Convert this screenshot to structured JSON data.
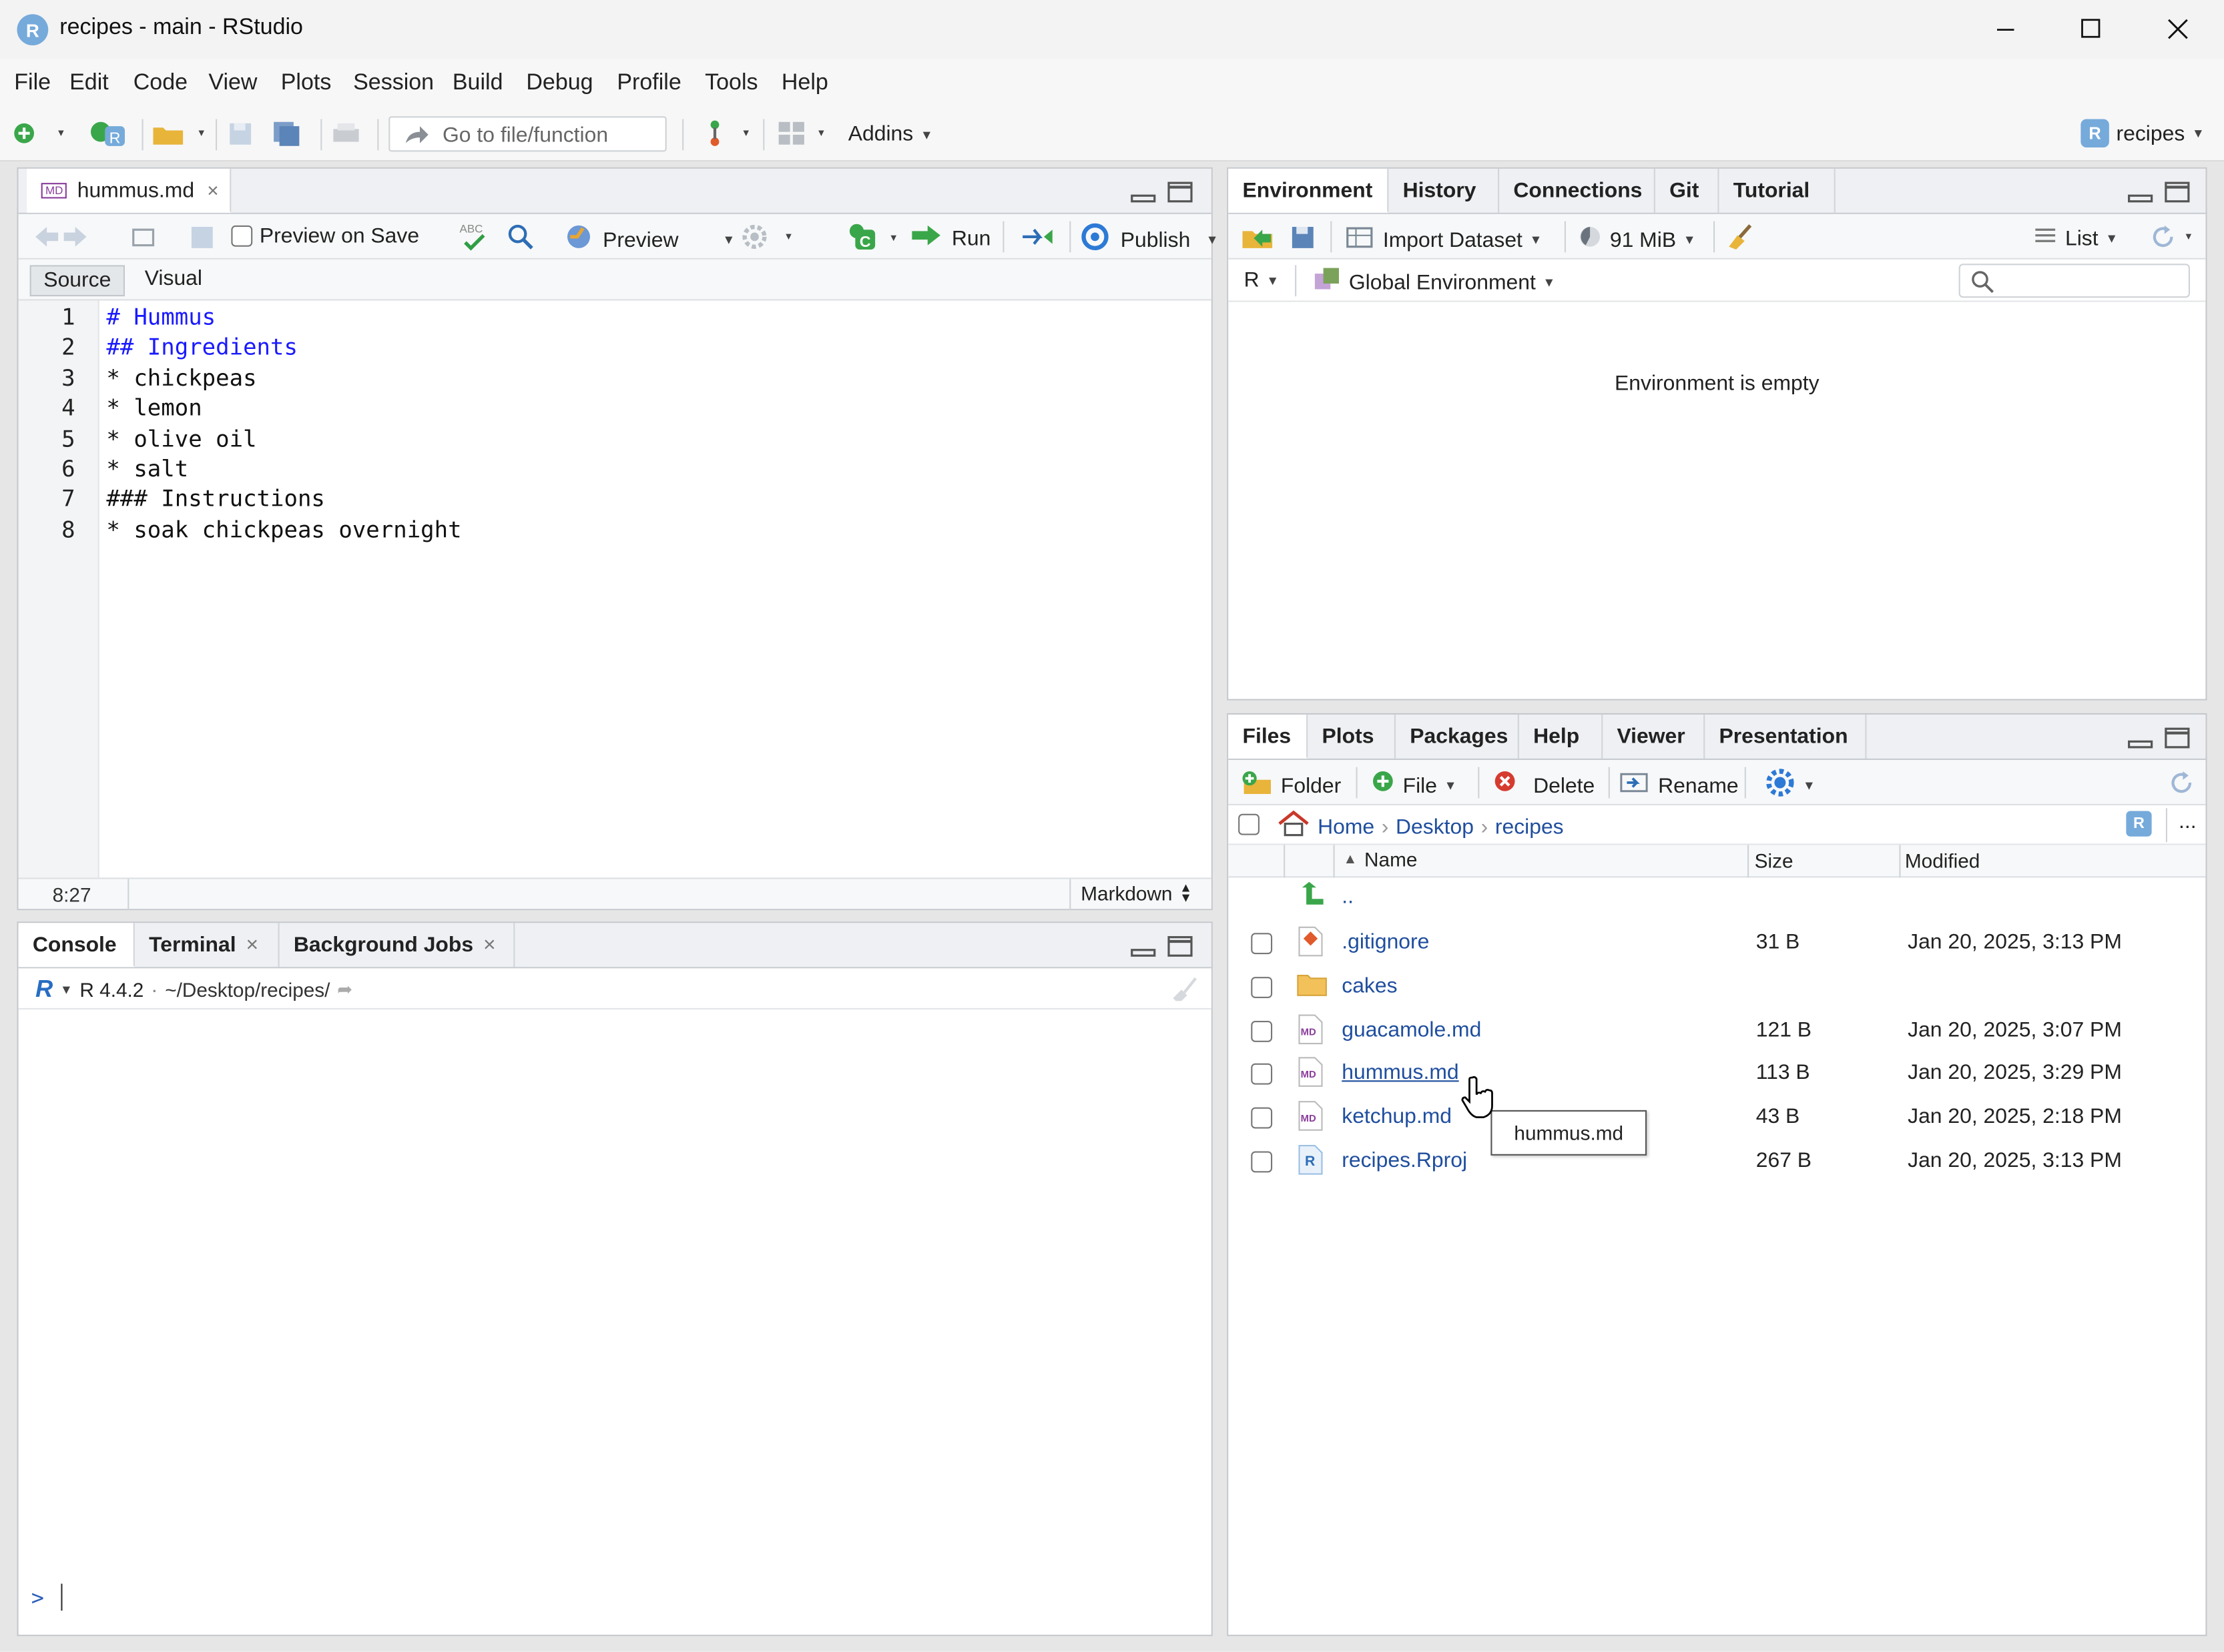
{
  "window": {
    "title": "recipes - main - RStudio"
  },
  "menu": [
    "File",
    "Edit",
    "Code",
    "View",
    "Plots",
    "Session",
    "Build",
    "Debug",
    "Profile",
    "Tools",
    "Help"
  ],
  "toolbar": {
    "goto_placeholder": "Go to file/function",
    "addins_label": "Addins",
    "project_label": "recipes"
  },
  "editor": {
    "tab_label": "hummus.md",
    "preview_on_save_label": "Preview on Save",
    "preview_label": "Preview",
    "run_label": "Run",
    "publish_label": "Publish",
    "source_label": "Source",
    "visual_label": "Visual",
    "lines": [
      {
        "n": "1",
        "text": "# Hummus",
        "kind": "h"
      },
      {
        "n": "2",
        "text": "## Ingredients",
        "kind": "h"
      },
      {
        "n": "3",
        "text": "* chickpeas",
        "kind": "t"
      },
      {
        "n": "4",
        "text": "* lemon",
        "kind": "t"
      },
      {
        "n": "5",
        "text": "* olive oil",
        "kind": "t"
      },
      {
        "n": "6",
        "text": "* salt",
        "kind": "t"
      },
      {
        "n": "7",
        "text": "### Instructions",
        "kind": "t"
      },
      {
        "n": "8",
        "text": "* soak chickpeas overnight",
        "kind": "t"
      }
    ],
    "cursor_pos": "8:27",
    "file_type": "Markdown"
  },
  "console": {
    "tabs": [
      "Console",
      "Terminal",
      "Background Jobs"
    ],
    "r_version": "R 4.4.2",
    "working_dir": "~/Desktop/recipes/",
    "prompt": ">"
  },
  "environment": {
    "tabs": [
      "Environment",
      "History",
      "Connections",
      "Git",
      "Tutorial"
    ],
    "import_label": "Import Dataset",
    "memory_label": "91 MiB",
    "list_label": "List",
    "language_label": "R",
    "scope_label": "Global Environment",
    "empty_text": "Environment is empty"
  },
  "files": {
    "tabs": [
      "Files",
      "Plots",
      "Packages",
      "Help",
      "Viewer",
      "Presentation"
    ],
    "toolbar": {
      "folder": "Folder",
      "file": "File",
      "delete": "Delete",
      "rename": "Rename"
    },
    "breadcrumb": [
      "Home",
      "Desktop",
      "recipes"
    ],
    "more_label": "...",
    "columns": {
      "name": "Name",
      "size": "Size",
      "modified": "Modified"
    },
    "parent_label": "..",
    "rows": [
      {
        "name": ".gitignore",
        "size": "31 B",
        "modified": "Jan 20, 2025, 3:13 PM",
        "icon": "git-file-icon"
      },
      {
        "name": "cakes",
        "size": "",
        "modified": "",
        "icon": "folder-icon"
      },
      {
        "name": "guacamole.md",
        "size": "121 B",
        "modified": "Jan 20, 2025, 3:07 PM",
        "icon": "markdown-file-icon"
      },
      {
        "name": "hummus.md",
        "size": "113 B",
        "modified": "Jan 20, 2025, 3:29 PM",
        "icon": "markdown-file-icon"
      },
      {
        "name": "ketchup.md",
        "size": "43 B",
        "modified": "Jan 20, 2025, 2:18 PM",
        "icon": "markdown-file-icon"
      },
      {
        "name": "recipes.Rproj",
        "size": "267 B",
        "modified": "Jan 20, 2025, 3:13 PM",
        "icon": "rproj-file-icon"
      }
    ],
    "tooltip": "hummus.md"
  },
  "colors": {
    "heading": "#1a1aff",
    "link": "#1f4e9e",
    "accent": "#2d7ad6"
  }
}
